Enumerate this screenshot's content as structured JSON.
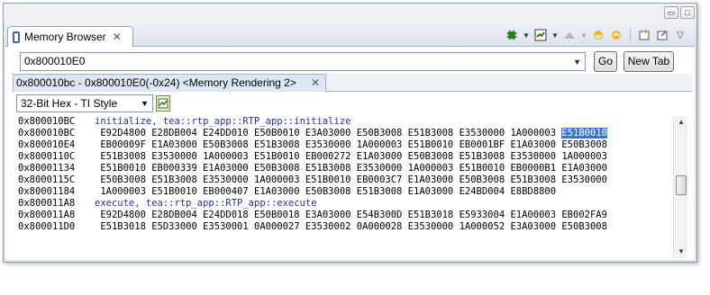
{
  "view_tab": {
    "label": "Memory Browser",
    "close": "✕"
  },
  "window": {
    "minimize": "▭",
    "maximize": "□"
  },
  "address": {
    "value": "0x800010E0"
  },
  "buttons": {
    "go": "Go",
    "new_tab": "New Tab"
  },
  "rendering_tab": {
    "label": "0x800010bc - 0x800010E0(-0x24) <Memory Rendering 2>",
    "close": "✕"
  },
  "format": {
    "selected": "32-Bit Hex - TI Style"
  },
  "memory": {
    "lines": [
      {
        "addr": "0x800010BC",
        "label": "initialize, tea::rtp_app::RTP_app::initialize"
      },
      {
        "addr": "0x800010BC",
        "words": [
          "E92D4800",
          "E28DB004",
          "E24DD010",
          "E50B0010",
          "E3A03000",
          "E50B3008",
          "E51B3008",
          "E3530000",
          "1A000003"
        ],
        "highlight": "E51B0010"
      },
      {
        "addr": "0x800010E4",
        "words": [
          "EB00009F",
          "E1A03000",
          "E50B3008",
          "E51B3008",
          "E3530000",
          "1A000003",
          "E51B0010",
          "EB0001BF",
          "E1A03000",
          "E50B3008"
        ]
      },
      {
        "addr": "0x8000110C",
        "words": [
          "E51B3008",
          "E3530000",
          "1A000003",
          "E51B0010",
          "EB000272",
          "E1A03000",
          "E50B3008",
          "E51B3008",
          "E3530000",
          "1A000003"
        ]
      },
      {
        "addr": "0x80001134",
        "words": [
          "E51B0010",
          "EB000339",
          "E1A03000",
          "E50B3008",
          "E51B3008",
          "E3530000",
          "1A000003",
          "E51B0010",
          "EB0000B1",
          "E1A03000"
        ]
      },
      {
        "addr": "0x8000115C",
        "words": [
          "E50B3008",
          "E51B3008",
          "E3530000",
          "1A000003",
          "E51B0010",
          "EB0003C7",
          "E1A03000",
          "E50B3008",
          "E51B3008",
          "E3530000"
        ]
      },
      {
        "addr": "0x80001184",
        "words": [
          "1A000003",
          "E51B0010",
          "EB000407",
          "E1A03000",
          "E50B3008",
          "E51B3008",
          "E1A03000",
          "E24BD004",
          "E8BD8800"
        ]
      },
      {
        "addr": "0x800011A8",
        "label": "execute, tea::rtp_app::RTP_app::execute"
      },
      {
        "addr": "0x800011A8",
        "words": [
          "E92D4800",
          "E28DB004",
          "E24DD018",
          "E50B0018",
          "E3A03000",
          "E54B300D",
          "E51B3018",
          "E5933004",
          "E1A00003",
          "EB002FA9"
        ]
      },
      {
        "addr": "0x800011D0",
        "words": [
          "E51B3018",
          "E5D33000",
          "E3530001",
          "0A000027",
          "E3530002",
          "0A000028",
          "E3530000",
          "1A000052",
          "E3A03000",
          "E50B3008"
        ]
      }
    ]
  },
  "colors": {
    "label": "#1f2fb8",
    "highlight_bg": "#3875d7",
    "frame": "#8a9bb0"
  },
  "icons": [
    "connect-icon",
    "new-rendering-icon",
    "gray-chip-icon",
    "import-icon",
    "export-icon",
    "new-window-icon",
    "pin-icon",
    "view-menu-icon"
  ]
}
